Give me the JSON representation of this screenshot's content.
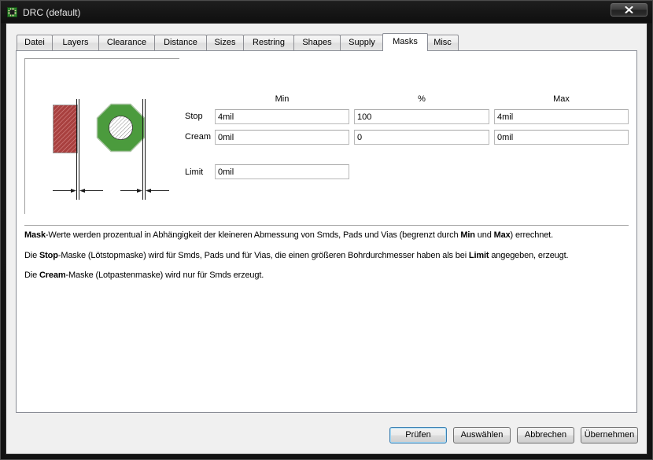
{
  "window": {
    "title": "DRC (default)"
  },
  "icons": {
    "app": "eagle-app-icon",
    "close": "close-icon"
  },
  "tabs": [
    {
      "label": "Datei",
      "selected": false
    },
    {
      "label": "Layers",
      "selected": false
    },
    {
      "label": "Clearance",
      "selected": false
    },
    {
      "label": "Distance",
      "selected": false
    },
    {
      "label": "Sizes",
      "selected": false
    },
    {
      "label": "Restring",
      "selected": false
    },
    {
      "label": "Shapes",
      "selected": false
    },
    {
      "label": "Supply",
      "selected": false
    },
    {
      "label": "Masks",
      "selected": true
    },
    {
      "label": "Misc",
      "selected": false
    }
  ],
  "masks": {
    "columns": {
      "min": "Min",
      "percent": "%",
      "max": "Max"
    },
    "stop": {
      "label": "Stop",
      "min": "4mil",
      "percent": "100",
      "max": "4mil"
    },
    "cream": {
      "label": "Cream",
      "min": "0mil",
      "percent": "0",
      "max": "0mil"
    },
    "limit": {
      "label": "Limit",
      "value": "0mil"
    }
  },
  "description": [
    [
      {
        "text": "Mask",
        "bold": true
      },
      {
        "text": "-Werte werden prozentual in Abhängigkeit der kleineren Abmessung von Smds, Pads und Vias (begrenzt durch ",
        "bold": false
      },
      {
        "text": "Min",
        "bold": true
      },
      {
        "text": " und ",
        "bold": false
      },
      {
        "text": "Max",
        "bold": true
      },
      {
        "text": ") errechnet.",
        "bold": false
      }
    ],
    [
      {
        "text": "Die ",
        "bold": false
      },
      {
        "text": "Stop",
        "bold": true
      },
      {
        "text": "-Maske (Lötstopmaske) wird für Smds, Pads und für Vias, die einen größeren Bohrdurchmesser haben als bei ",
        "bold": false
      },
      {
        "text": "Limit",
        "bold": true
      },
      {
        "text": " angegeben, erzeugt.",
        "bold": false
      }
    ],
    [
      {
        "text": "Die ",
        "bold": false
      },
      {
        "text": "Cream",
        "bold": true
      },
      {
        "text": "-Maske (Lotpastenmaske) wird nur für Smds erzeugt.",
        "bold": false
      }
    ]
  ],
  "buttons": [
    {
      "label": "Prüfen",
      "default": true
    },
    {
      "label": "Auswählen",
      "default": false
    },
    {
      "label": "Abbrechen",
      "default": false
    },
    {
      "label": "Übernehmen",
      "default": false
    }
  ],
  "colors": {
    "title_bar": "#141414",
    "dialog_bg": "#f0f0f0",
    "panel_bg": "#ffffff",
    "pad_fill": "#a8403f",
    "pad_hatch": "#d98a8a",
    "via_fill": "#4b9b3d",
    "via_outline": "#a9c4a2",
    "hole_hatch": "#8a8a8a",
    "default_button_border": "#3c7fb1"
  }
}
